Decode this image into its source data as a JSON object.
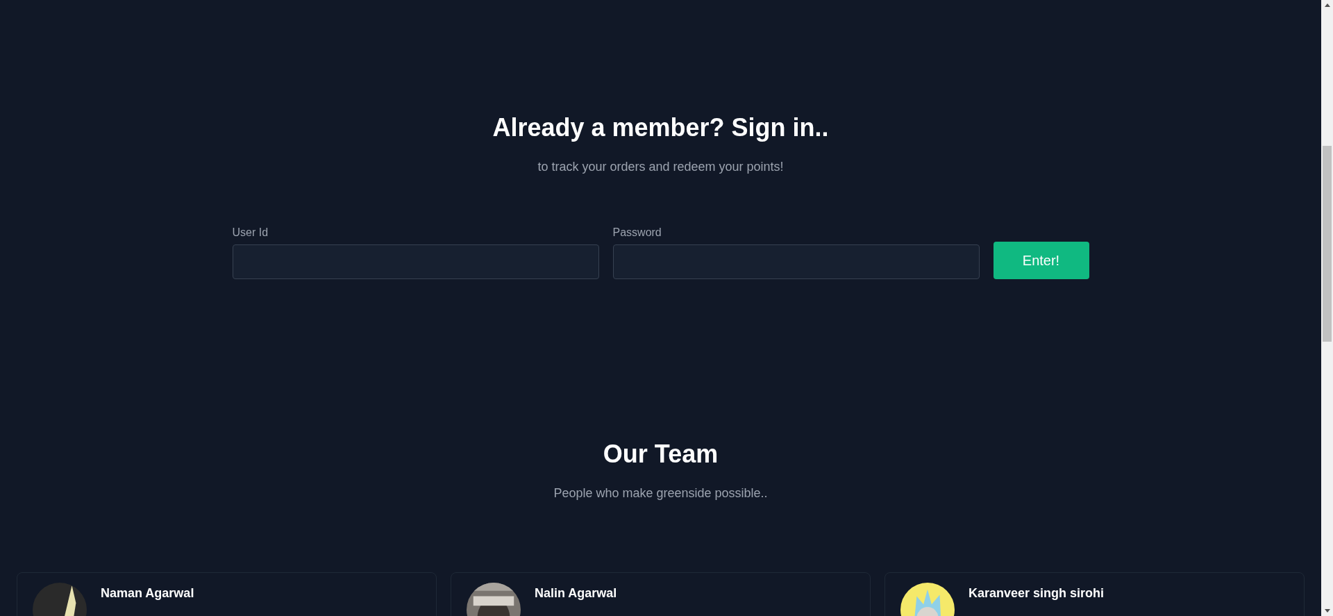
{
  "signin": {
    "title": "Already a member? Sign in..",
    "subtitle": "to track your orders and redeem your points!",
    "fields": [
      {
        "label": "User Id"
      },
      {
        "label": "Password"
      }
    ],
    "button": "Enter!"
  },
  "team": {
    "title": "Our Team",
    "subtitle": "People who make greenside possible..",
    "members": [
      {
        "name": "Naman Agarwal"
      },
      {
        "name": "Nalin Agarwal"
      },
      {
        "name": "Karanveer singh sirohi"
      }
    ]
  }
}
